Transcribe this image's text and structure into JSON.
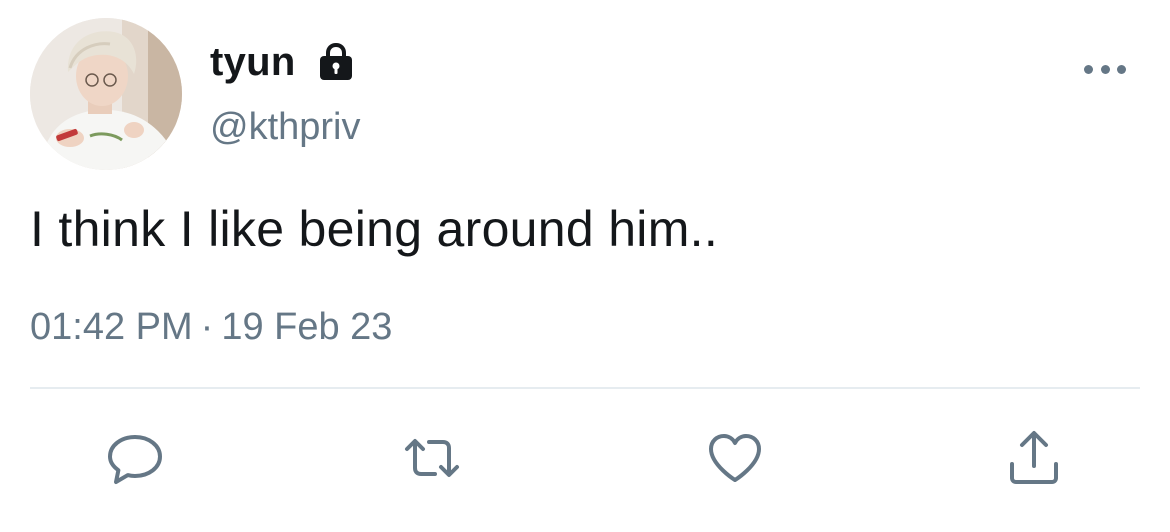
{
  "tweet": {
    "author": {
      "display_name": "tyun",
      "handle": "@kthpriv",
      "protected_icon": "lock-icon",
      "avatar": "profile-photo"
    },
    "text": "I think I like being around him..",
    "time": "01:42 PM",
    "separator": "·",
    "date": "19 Feb 23"
  },
  "actions": [
    {
      "name": "reply",
      "icon": "speech-bubble-icon"
    },
    {
      "name": "retweet",
      "icon": "retweet-arrows-icon"
    },
    {
      "name": "like",
      "icon": "heart-icon"
    },
    {
      "name": "share",
      "icon": "upload-share-icon"
    }
  ],
  "colors": {
    "text_primary": "#14171a",
    "text_secondary": "#657786",
    "divider": "#e6ecf0",
    "icon": "#657786"
  }
}
